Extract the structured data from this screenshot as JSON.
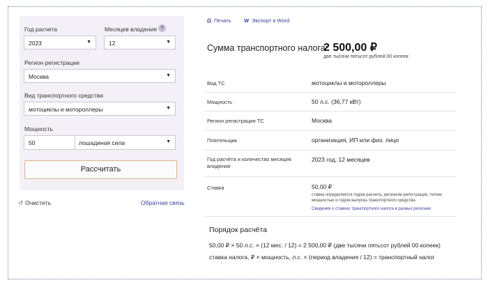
{
  "form": {
    "year_label": "Год расчета",
    "year_value": "2023",
    "months_label": "Месяцев владения",
    "months_value": "12",
    "help_glyph": "?",
    "region_label": "Регион регистрации",
    "region_value": "Москва",
    "vehicle_label": "Вид транспортного средства",
    "vehicle_value": "мотоциклы и мотороллеры",
    "power_label": "Мощность",
    "power_value": "50",
    "power_unit": "лошадиная сила",
    "calculate_button": "Рассчитать",
    "reset_label": "Очистить",
    "feedback_link": "Обратная связь"
  },
  "toolbar": {
    "print_label": "Печать",
    "export_label": "Экспорт в Word"
  },
  "result": {
    "sum_label": "Сумма транспортного налога:",
    "sum_value": "2 500,00 ₽",
    "sum_words": "две тысячи пятьсот рублей 00 копеек",
    "rows": [
      {
        "label": "Вид ТС",
        "value": "мотоциклы и мотороллеры"
      },
      {
        "label": "Мощность",
        "value": "50 л.с. (36,77 кВт)"
      },
      {
        "label": "Регион регистрации ТС",
        "value": "Москва"
      },
      {
        "label": "Плательщик",
        "value": "организация, ИП или физ. лицо"
      },
      {
        "label": "Год расчёта и количество месяцев владения",
        "value": "2023 год, 12 месяцев"
      },
      {
        "label": "Ставка",
        "value": "50,00 ₽"
      }
    ],
    "rate_note": "ставка определяется годом расчета, регионом регистрации, типом, мощностью и годом выпуска транспортного средства",
    "rate_link": "Сведения о ставках транспортного налога в разных регионах",
    "order_title": "Порядок расчёта",
    "formula_1": "50,00 ₽ × 50 л.с. × (12 мес. / 12) = 2 500,00 ₽ (две тысячи пятьсот рублей 00 копеек)",
    "formula_2": "ставка налога, ₽ × мощность, л.с. × (период владения / 12) = транспортный налог"
  },
  "icons": {
    "print": "printer-icon",
    "export": "word-icon",
    "reset": "reset-icon",
    "caret": "chevron-down-icon"
  },
  "colors": {
    "panel_bg": "#f3f1f7",
    "link": "#3b3f9c",
    "button_border": "#e0b48a"
  }
}
